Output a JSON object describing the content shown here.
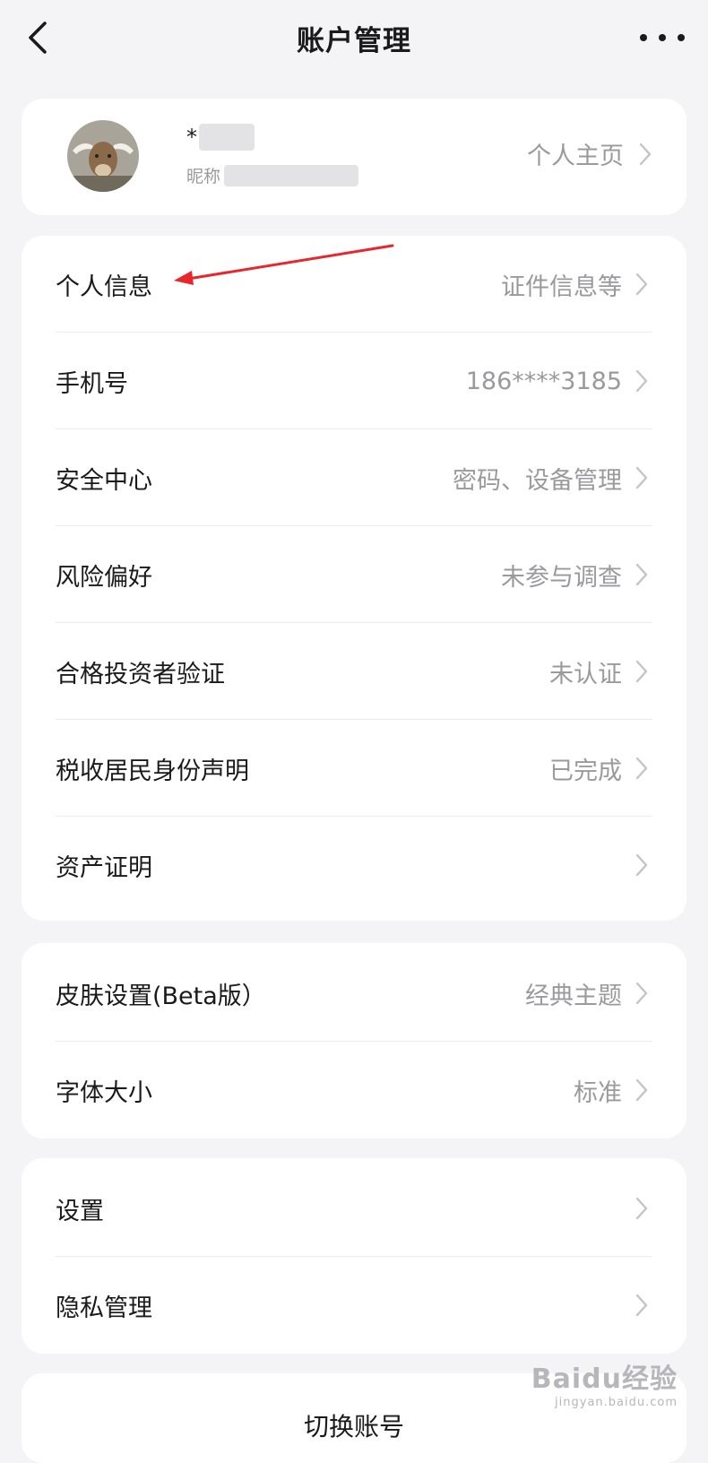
{
  "header": {
    "title": "账户管理",
    "back_icon": "chevron-left-icon",
    "more_icon": "more-dots-icon"
  },
  "profile": {
    "name_prefix": "*",
    "nickname_prefix": "昵称",
    "homepage_label": "个人主页"
  },
  "sections": {
    "account": [
      {
        "label": "个人信息",
        "value": "证件信息等"
      },
      {
        "label": "手机号",
        "value": "186****3185"
      },
      {
        "label": "安全中心",
        "value": "密码、设备管理"
      },
      {
        "label": "风险偏好",
        "value": "未参与调查"
      },
      {
        "label": "合格投资者验证",
        "value": "未认证"
      },
      {
        "label": "税收居民身份声明",
        "value": "已完成"
      },
      {
        "label": "资产证明",
        "value": ""
      }
    ],
    "display": [
      {
        "label": "皮肤设置(Beta版）",
        "value": "经典主题"
      },
      {
        "label": "字体大小",
        "value": "标准"
      }
    ],
    "system": [
      {
        "label": "设置",
        "value": ""
      },
      {
        "label": "隐私管理",
        "value": ""
      }
    ]
  },
  "switch_account": {
    "label": "切换账号"
  },
  "watermark": {
    "brand": "Baidu经验",
    "url": "jingyan.baidu.com"
  },
  "colors": {
    "background": "#f4f4f6",
    "card": "#ffffff",
    "text_primary": "#1a1a1a",
    "text_secondary": "#9a9a9e",
    "annotation_arrow": "#e8262c"
  }
}
